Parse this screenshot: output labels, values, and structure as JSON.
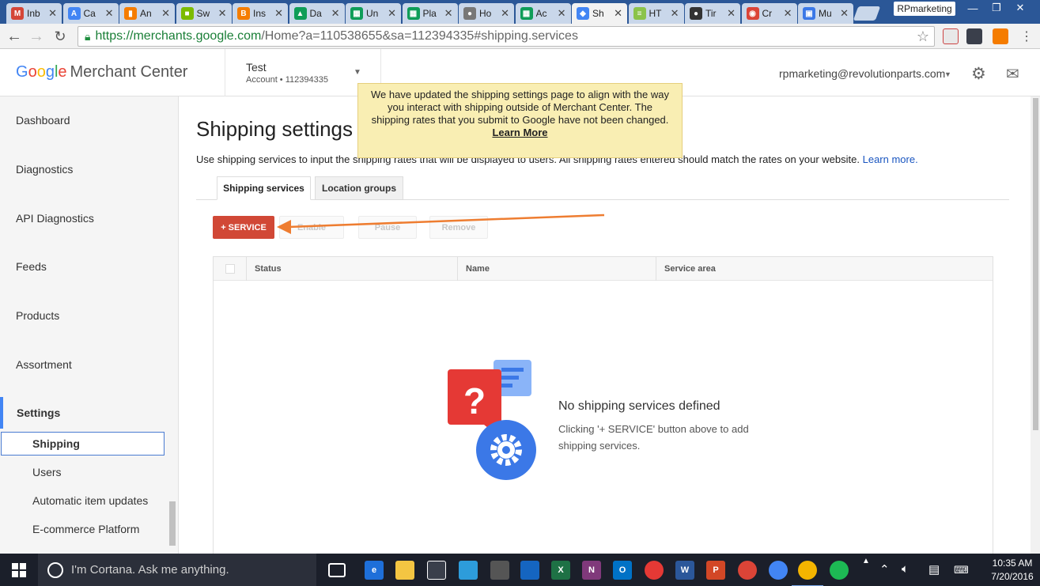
{
  "browser": {
    "tabs": [
      {
        "label": "Inb",
        "icon": "gmail-icon",
        "color": "#d44638",
        "glyph": "M"
      },
      {
        "label": "Ca",
        "icon": "adwords-icon",
        "color": "#4285f4",
        "glyph": "A"
      },
      {
        "label": "An",
        "icon": "analytics-icon",
        "color": "#f57c00",
        "glyph": "▮"
      },
      {
        "label": "Sw",
        "icon": "microsoft-icon",
        "color": "#7cbb00",
        "glyph": "■"
      },
      {
        "label": "Ins",
        "icon": "blogger-icon",
        "color": "#f57d00",
        "glyph": "B"
      },
      {
        "label": "Da",
        "icon": "drive-icon",
        "color": "#0f9d58",
        "glyph": "▲"
      },
      {
        "label": "Un",
        "icon": "sheets-icon",
        "color": "#0f9d58",
        "glyph": "▦"
      },
      {
        "label": "Pla",
        "icon": "sheets-icon",
        "color": "#0f9d58",
        "glyph": "▦"
      },
      {
        "label": "Ho",
        "icon": "chat-icon",
        "color": "#777777",
        "glyph": "●"
      },
      {
        "label": "Ac",
        "icon": "sheets-icon",
        "color": "#0f9d58",
        "glyph": "▦"
      },
      {
        "label": "Sh",
        "icon": "merchant-center-icon",
        "color": "#4285f4",
        "glyph": "◆",
        "active": true
      },
      {
        "label": "HT",
        "icon": "html-icon",
        "color": "#8bc34a",
        "glyph": "≡"
      },
      {
        "label": "Tir",
        "icon": "panda-icon",
        "color": "#333333",
        "glyph": "●"
      },
      {
        "label": "Cr",
        "icon": "chrome-icon",
        "color": "#db4437",
        "glyph": "◉"
      },
      {
        "label": "Mu",
        "icon": "app-icon",
        "color": "#3b78e7",
        "glyph": "▣"
      }
    ],
    "profile_name": "RPmarketing",
    "window_buttons": {
      "minimize": "—",
      "restore": "❐",
      "close": "✕"
    },
    "url_host": "https://merchants.google.com",
    "url_rest": "/Home?a=110538655&sa=112394335#shipping.services"
  },
  "header": {
    "logo_google": [
      "G",
      "o",
      "o",
      "g",
      "l",
      "e"
    ],
    "logo_product": "Merchant Center",
    "account_name": "Test",
    "account_sub": "Account  •  112394335",
    "user_email": "rpmarketing@revolutionparts.com"
  },
  "sidebar": {
    "items": [
      "Dashboard",
      "Diagnostics",
      "API Diagnostics",
      "Feeds",
      "Products",
      "Assortment",
      "Settings"
    ],
    "sub_items": [
      "Shipping",
      "Users",
      "Automatic item updates",
      "E-commerce Platform"
    ]
  },
  "main": {
    "title": "Shipping settings",
    "intro": "Use shipping services to input the shipping rates that will be displayed to users. All shipping rates entered should match the rates on your website.",
    "intro_link": "Learn more.",
    "tabs": [
      "Shipping services",
      "Location groups"
    ],
    "buttons": {
      "service": "+ SERVICE",
      "enable": "Enable",
      "pause": "Pause",
      "remove": "Remove"
    },
    "columns": [
      "Status",
      "Name",
      "Service area"
    ],
    "empty_title": "No shipping services defined",
    "empty_desc": "Clicking '+ SERVICE' button above to add shipping services."
  },
  "tooltip": {
    "text": "We have updated the shipping settings page to align with the way you interact with shipping outside of Merchant Center. The shipping rates that you submit to Google have not been changed.",
    "link": "Learn More"
  },
  "taskbar": {
    "cortana": "I'm Cortana. Ask me anything.",
    "time": "10:35 AM",
    "date": "7/20/2016"
  },
  "colors": {
    "accent_red": "#d14836",
    "arrow": "#ee7d31",
    "tooltip_bg": "#f9eeb3",
    "link": "#1a56c0"
  }
}
